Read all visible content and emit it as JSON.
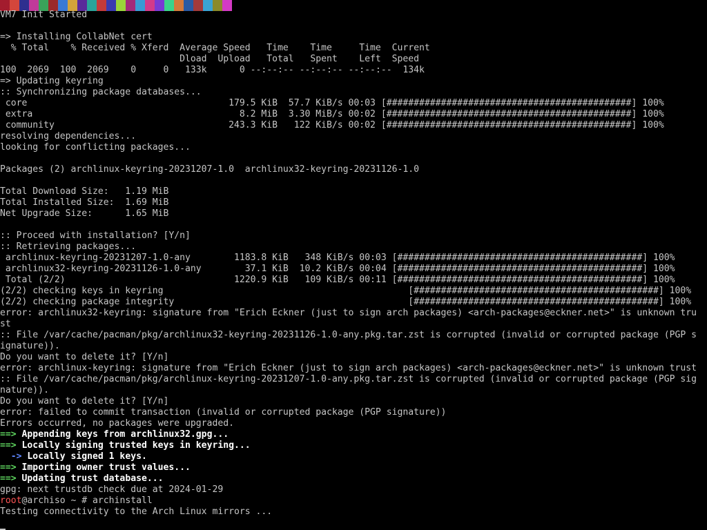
{
  "colorbar": [
    "#a31c2e",
    "#d4463b",
    "#2f2f8f",
    "#c03a9a",
    "#3aa35a",
    "#9a2a2a",
    "#3a7ad4",
    "#d4a43a",
    "#5a2a9a",
    "#2aa39a",
    "#c43a3a",
    "#3a3ab0",
    "#9ad43a",
    "#a32a7a",
    "#3a9ad4",
    "#d43a8a",
    "#7a3ad4",
    "#3ad48a",
    "#d47a3a",
    "#2a5aa3",
    "#a33a3a",
    "#3aa3d4",
    "#8a8a2a",
    "#d43ac4"
  ],
  "lines": [
    {
      "segments": [
        {
          "text": "VM7 Init Started"
        }
      ]
    },
    {
      "segments": [
        {
          "text": ""
        }
      ]
    },
    {
      "segments": [
        {
          "text": "=> Installing CollabNet cert"
        }
      ]
    },
    {
      "segments": [
        {
          "text": "  % Total    % Received % Xferd  Average Speed   Time    Time     Time  Current"
        }
      ]
    },
    {
      "segments": [
        {
          "text": "                                 Dload  Upload   Total   Spent    Left  Speed"
        }
      ]
    },
    {
      "segments": [
        {
          "text": "100  2069  100  2069    0     0   133k      0 --:--:-- --:--:-- --:--:--  134k"
        }
      ]
    },
    {
      "segments": [
        {
          "text": "=> Updating keyring"
        }
      ]
    },
    {
      "segments": [
        {
          "text": ":: Synchronizing package databases..."
        }
      ]
    },
    {
      "segments": [
        {
          "text": " core                                     179.5 KiB  57.7 KiB/s 00:03 [#############################################] 100%"
        }
      ]
    },
    {
      "segments": [
        {
          "text": " extra                                      8.2 MiB  3.30 MiB/s 00:02 [#############################################] 100%"
        }
      ]
    },
    {
      "segments": [
        {
          "text": " community                                243.3 KiB   122 KiB/s 00:02 [#############################################] 100%"
        }
      ]
    },
    {
      "segments": [
        {
          "text": "resolving dependencies..."
        }
      ]
    },
    {
      "segments": [
        {
          "text": "looking for conflicting packages..."
        }
      ]
    },
    {
      "segments": [
        {
          "text": ""
        }
      ]
    },
    {
      "segments": [
        {
          "text": "Packages (2) archlinux-keyring-20231207-1.0  archlinux32-keyring-20231126-1.0"
        }
      ]
    },
    {
      "segments": [
        {
          "text": ""
        }
      ]
    },
    {
      "segments": [
        {
          "text": "Total Download Size:   1.19 MiB"
        }
      ]
    },
    {
      "segments": [
        {
          "text": "Total Installed Size:  1.69 MiB"
        }
      ]
    },
    {
      "segments": [
        {
          "text": "Net Upgrade Size:      1.65 MiB"
        }
      ]
    },
    {
      "segments": [
        {
          "text": ""
        }
      ]
    },
    {
      "segments": [
        {
          "text": ":: Proceed with installation? [Y/n]"
        }
      ]
    },
    {
      "segments": [
        {
          "text": ":: Retrieving packages..."
        }
      ]
    },
    {
      "segments": [
        {
          "text": " archlinux-keyring-20231207-1.0-any        1183.8 KiB   348 KiB/s 00:03 [#############################################] 100%"
        }
      ]
    },
    {
      "segments": [
        {
          "text": " archlinux32-keyring-20231126-1.0-any        37.1 KiB  10.2 KiB/s 00:04 [#############################################] 100%"
        }
      ]
    },
    {
      "segments": [
        {
          "text": " Total (2/2)                               1220.9 KiB   109 KiB/s 00:11 [#############################################] 100%"
        }
      ]
    },
    {
      "segments": [
        {
          "text": "(2/2) checking keys in keyring                                             [#############################################] 100%"
        }
      ]
    },
    {
      "segments": [
        {
          "text": "(2/2) checking package integrity                                           [#############################################] 100%"
        }
      ]
    },
    {
      "segments": [
        {
          "text": "error: archlinux32-keyring: signature from \"Erich Eckner (just to sign arch packages) <arch-packages@eckner.net>\" is unknown tru"
        }
      ]
    },
    {
      "segments": [
        {
          "text": "st"
        }
      ]
    },
    {
      "segments": [
        {
          "text": ":: File /var/cache/pacman/pkg/archlinux32-keyring-20231126-1.0-any.pkg.tar.zst is corrupted (invalid or corrupted package (PGP s"
        }
      ]
    },
    {
      "segments": [
        {
          "text": "ignature))."
        }
      ]
    },
    {
      "segments": [
        {
          "text": "Do you want to delete it? [Y/n]"
        }
      ]
    },
    {
      "segments": [
        {
          "text": "error: archlinux-keyring: signature from \"Erich Eckner (just to sign arch packages) <arch-packages@eckner.net>\" is unknown trust"
        }
      ]
    },
    {
      "segments": [
        {
          "text": ":: File /var/cache/pacman/pkg/archlinux-keyring-20231207-1.0-any.pkg.tar.zst is corrupted (invalid or corrupted package (PGP sig"
        }
      ]
    },
    {
      "segments": [
        {
          "text": "nature))."
        }
      ]
    },
    {
      "segments": [
        {
          "text": "Do you want to delete it? [Y/n]"
        }
      ]
    },
    {
      "segments": [
        {
          "text": "error: failed to commit transaction (invalid or corrupted package (PGP signature))"
        }
      ]
    },
    {
      "segments": [
        {
          "text": "Errors occurred, no packages were upgraded."
        }
      ]
    },
    {
      "segments": [
        {
          "text": "==>",
          "style": "arrow-green"
        },
        {
          "text": " Appending keys from archlinux32.gpg...",
          "style": "bold"
        }
      ]
    },
    {
      "segments": [
        {
          "text": "==>",
          "style": "arrow-green"
        },
        {
          "text": " Locally signing trusted keys in keyring...",
          "style": "bold"
        }
      ]
    },
    {
      "segments": [
        {
          "text": "  -> ",
          "style": "arrow-blue"
        },
        {
          "text": "Locally signed 1 keys.",
          "style": "bold"
        }
      ]
    },
    {
      "segments": [
        {
          "text": "==>",
          "style": "arrow-green"
        },
        {
          "text": " Importing owner trust values...",
          "style": "bold"
        }
      ]
    },
    {
      "segments": [
        {
          "text": "==>",
          "style": "arrow-green"
        },
        {
          "text": " Updating trust database...",
          "style": "bold"
        }
      ]
    },
    {
      "segments": [
        {
          "text": "gpg: next trustdb check due at 2024-01-29"
        }
      ]
    },
    {
      "segments": [
        {
          "text": "root",
          "style": "red"
        },
        {
          "text": "@archiso ~ # archinstall"
        }
      ]
    },
    {
      "segments": [
        {
          "text": "Testing connectivity to the Arch Linux mirrors ..."
        }
      ]
    }
  ]
}
